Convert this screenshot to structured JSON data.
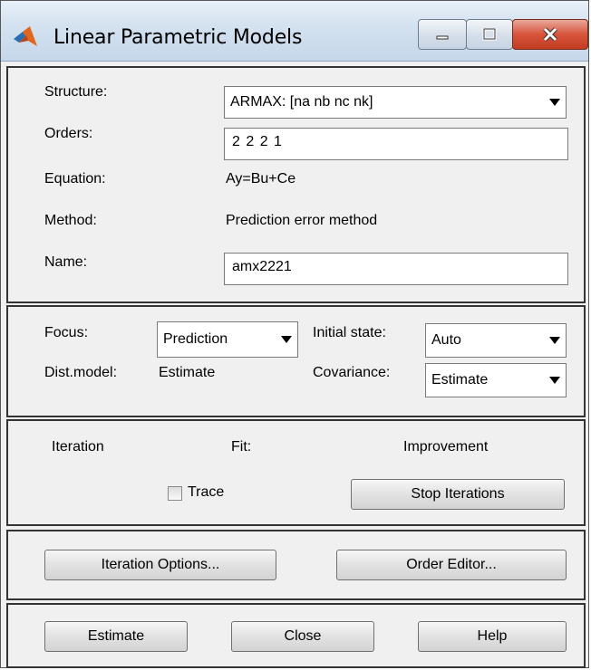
{
  "window": {
    "title": "Linear Parametric Models",
    "icon": "matlab-logo-icon"
  },
  "model": {
    "structure_label": "Structure:",
    "structure_value": "ARMAX: [na nb nc nk]",
    "orders_label": "Orders:",
    "orders_value": "2 2 2 1",
    "equation_label": "Equation:",
    "equation_value": "Ay=Bu+Ce",
    "method_label": "Method:",
    "method_value": "Prediction error method",
    "name_label": "Name:",
    "name_value": "amx2221"
  },
  "options": {
    "focus_label": "Focus:",
    "focus_value": "Prediction",
    "initial_state_label": "Initial state:",
    "initial_state_value": "Auto",
    "dist_model_label": "Dist.model:",
    "dist_model_value": "Estimate",
    "covariance_label": "Covariance:",
    "covariance_value": "Estimate"
  },
  "iteration": {
    "iteration_label": "Iteration",
    "fit_label": "Fit:",
    "improvement_label": "Improvement",
    "trace_label": "Trace",
    "trace_checked": false,
    "stop_button": "Stop Iterations"
  },
  "editors": {
    "iteration_options_button": "Iteration Options...",
    "order_editor_button": "Order Editor..."
  },
  "actions": {
    "estimate_button": "Estimate",
    "close_button": "Close",
    "help_button": "Help"
  }
}
